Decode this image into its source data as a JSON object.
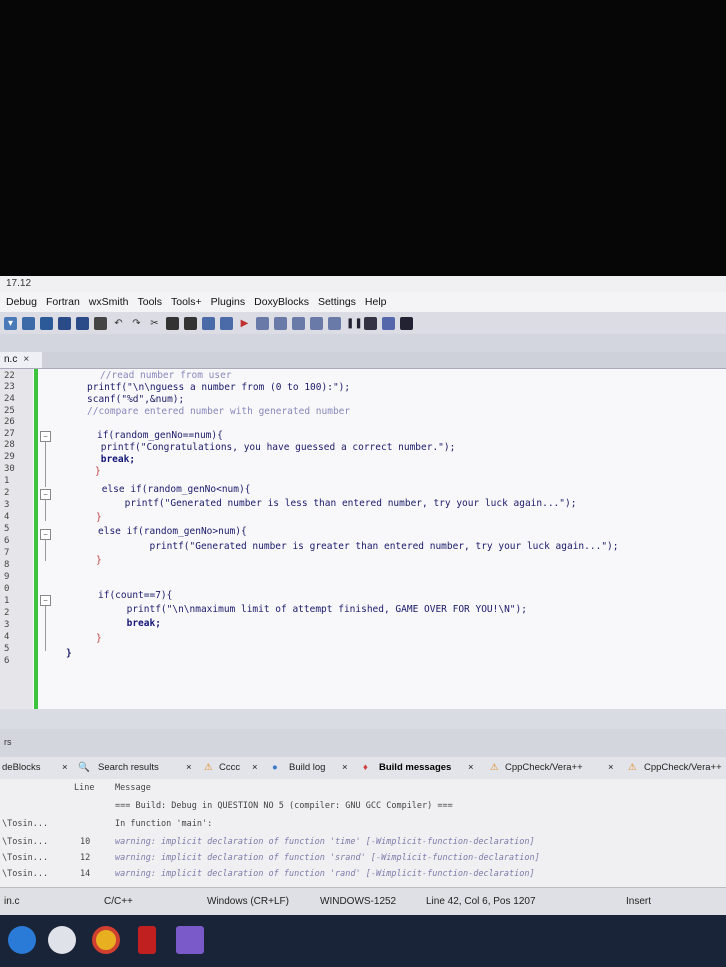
{
  "window": {
    "title": "17.12"
  },
  "menu": [
    "Debug",
    "Fortran",
    "wxSmith",
    "Tools",
    "Tools+",
    "Plugins",
    "DoxyBlocks",
    "Settings",
    "Help"
  ],
  "editor_tab": {
    "label": "n.c",
    "close": "×"
  },
  "line_numbers": [
    "22",
    "23",
    "24",
    "25",
    "26",
    "27",
    "28",
    "29",
    "30",
    "1",
    "2",
    "3",
    "4",
    "5",
    "6",
    "7",
    "8",
    "9",
    "0",
    "1",
    "2",
    "3",
    "4",
    "5",
    "6"
  ],
  "code_lines": [
    "//read number from user",
    "printf(\"\\n\\nguess a number from (0 to 100):\");",
    "scanf(\"%d\",&num);",
    "//compare entered number with generated number",
    "",
    "if(random_genNo==num){",
    " printf(\"Congratulations, you have guessed a correct number.\");",
    " break;",
    "}",
    " else if(random_genNo<num){",
    "     printf(\"Generated number is less than entered number, try your luck again...\");",
    "}",
    "else if(random_genNo>num){",
    "         printf(\"Generated number is greater than entered number, try your luck again...\");",
    "}",
    "",
    "if(count==7){",
    "     printf(\"\\n\\nmaximum limit of attempt finished, GAME OVER FOR YOU!\\N\");",
    "     break;",
    "}",
    "}"
  ],
  "panel_tabs": [
    "deBlocks",
    "Search results",
    "Cccc",
    "Build log",
    "Build messages",
    "CppCheck/Vera++",
    "CppCheck/Vera++"
  ],
  "panel_left_label": "rs",
  "messages": {
    "col_line": "Line",
    "col_message": "Message",
    "rows": [
      {
        "file": "",
        "line": "",
        "text": "=== Build: Debug in QUESTION NO 5 (compiler: GNU GCC Compiler) ==="
      },
      {
        "file": "\\Tosin...",
        "line": "",
        "text": "In function 'main':"
      },
      {
        "file": "\\Tosin...",
        "line": "10",
        "text": "warning: implicit declaration of function 'time' [-Wimplicit-function-declaration]"
      },
      {
        "file": "\\Tosin...",
        "line": "12",
        "text": "warning: implicit declaration of function 'srand' [-Wimplicit-function-declaration]"
      },
      {
        "file": "\\Tosin...",
        "line": "14",
        "text": "warning: implicit declaration of function 'rand' [-Wimplicit-function-declaration]"
      }
    ]
  },
  "status": {
    "file": "in.c",
    "language": "C/C++",
    "line_endings": "Windows (CR+LF)",
    "encoding": "WINDOWS-1252",
    "position": "Line 42, Col 6, Pos 1207",
    "mode": "Insert"
  },
  "colors": {
    "change_bar": "#3cc43c",
    "build_messages_icon": "#d04040",
    "taskbar": "#1a2438"
  }
}
